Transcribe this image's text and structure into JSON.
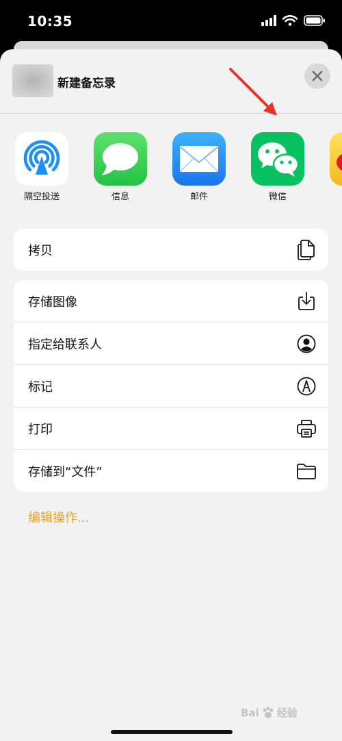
{
  "status_bar": {
    "time": "10:35"
  },
  "sheet": {
    "title": "新建备忘录",
    "close_symbol": "×"
  },
  "apps": [
    {
      "label": "隔空投送",
      "icon": "airdrop-icon"
    },
    {
      "label": "信息",
      "icon": "messages-icon"
    },
    {
      "label": "邮件",
      "icon": "mail-icon"
    },
    {
      "label": "微信",
      "icon": "wechat-icon"
    }
  ],
  "actions_group1": [
    {
      "label": "拷贝",
      "icon": "copy-icon"
    }
  ],
  "actions_group2": [
    {
      "label": "存储图像",
      "icon": "save-image-icon"
    },
    {
      "label": "指定给联系人",
      "icon": "assign-contact-icon"
    },
    {
      "label": "标记",
      "icon": "markup-icon"
    },
    {
      "label": "打印",
      "icon": "print-icon"
    },
    {
      "label": "存储到“文件”",
      "icon": "folder-icon"
    }
  ],
  "edit_actions": "编辑操作...",
  "watermark": {
    "brand": "Bai",
    "suffix": "经验"
  },
  "colors": {
    "accent": "#e3a22b",
    "arrow": "#e5352b",
    "messages_green": "#34c759",
    "mail_blue": "#1f8ff5",
    "wechat_green": "#07c160"
  }
}
